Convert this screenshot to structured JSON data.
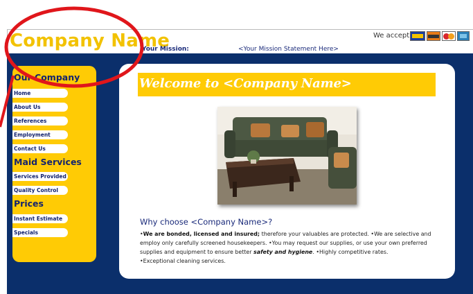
{
  "header": {
    "company_name": "Company Name",
    "mission_label": "Your Mission:",
    "mission_statement": "<Your Mission Statement Here>",
    "we_accept": "We accept:",
    "payment_icons": [
      "visa-card-icon",
      "discover-card-icon",
      "mastercard-icon",
      "amex-card-icon"
    ]
  },
  "sidebar": {
    "section1": "Our Company",
    "section1_items": [
      "Home",
      "About Us",
      "References",
      "Employment",
      "Contact Us"
    ],
    "section2": "Maid Services",
    "section2_items": [
      "Services Provided",
      "Quality Control"
    ],
    "section3": "Prices",
    "section3_items": [
      "Instant Estimate",
      "Specials"
    ]
  },
  "main": {
    "welcome": "Welcome to <Company Name>",
    "why_heading": "Why choose <Company Name>?",
    "why_p1_bold": "We are bonded, licensed and insured;",
    "why_p1_rest": " therefore your valuables are protected. ",
    "why_p2": "We are selective and employ only carefully screened housekeepers. ",
    "why_p3": "You may request our supplies, or use your own preferred supplies and equipment to ensure better ",
    "why_p3_emph": "safety and hygiene",
    "why_p3_end": ". ",
    "why_p4": "Highly competitive rates. ",
    "why_p5": "Exceptional cleaning services."
  },
  "colors": {
    "accent_yellow": "#FFCB05",
    "navy": "#0b2f6b",
    "annotation_red": "#E0161B"
  }
}
